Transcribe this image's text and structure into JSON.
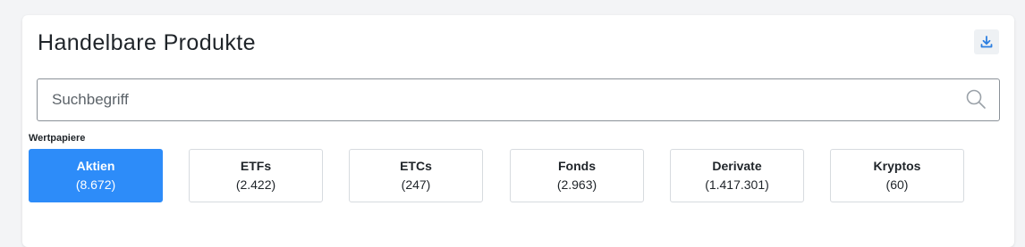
{
  "header": {
    "title": "Handelbare Produkte",
    "download_icon": "download-icon"
  },
  "search": {
    "placeholder": "Suchbegriff",
    "value": "",
    "icon": "search-icon"
  },
  "section": {
    "label": "Wertpapiere"
  },
  "tabs": [
    {
      "label": "Aktien",
      "count": "(8.672)",
      "active": true
    },
    {
      "label": "ETFs",
      "count": "(2.422)",
      "active": false
    },
    {
      "label": "ETCs",
      "count": "(247)",
      "active": false
    },
    {
      "label": "Fonds",
      "count": "(2.963)",
      "active": false
    },
    {
      "label": "Derivate",
      "count": "(1.417.301)",
      "active": false
    },
    {
      "label": "Kryptos",
      "count": "(60)",
      "active": false
    }
  ],
  "colors": {
    "accent": "#2d8cf9",
    "text": "#1f2429",
    "border": "#d7dbdf"
  }
}
